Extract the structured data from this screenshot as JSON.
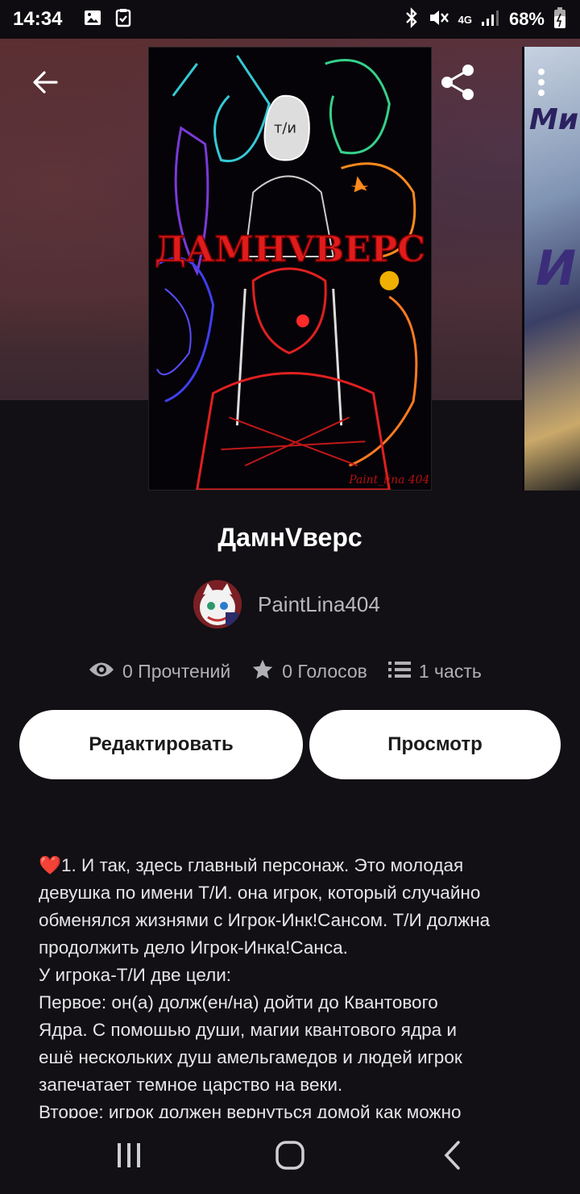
{
  "status_bar": {
    "time": "14:34",
    "battery": "68%",
    "network": "4G"
  },
  "story": {
    "title": "ДамнVверс",
    "cover_text": "ДАМНVВЕРС",
    "cover_caption": "Paint_lina 404",
    "cover_small": "т/и",
    "author": "PaintLina404"
  },
  "stats": {
    "reads": "0 Прочтений",
    "votes": "0 Голосов",
    "parts": "1 часть"
  },
  "buttons": {
    "edit": "Редактировать",
    "preview": "Просмотр"
  },
  "description": {
    "heart": "❤️",
    "lines": [
      "1. И так, здесь главный персонаж. Это молодая",
      "девушка по имени Т/И. она игрок, который случайно",
      "обменялся жизнями с Игрок-Инк!Сансом. Т/И должна",
      "продолжить дело Игрок-Инка!Санса.",
      "У игрока-Т/И две цели:",
      "Первое: он(а) долж(ен/на) дойти до Квантового",
      "Ядра. С помошью души, магии квантового ядра и",
      "ешё нескольких душ амельгамедов и людей игрок",
      "запечатает темное царство на веки.",
      "Второе: игрок должен вернуться домой как можно"
    ]
  },
  "icons": {
    "back": "arrow-left-icon",
    "share": "share-icon",
    "more": "more-vertical-icon",
    "reads": "eye-icon",
    "votes": "star-icon",
    "parts": "list-icon"
  },
  "colors": {
    "background": "#121014",
    "button_bg": "#ffffff",
    "accent_red": "#e23a2e"
  }
}
